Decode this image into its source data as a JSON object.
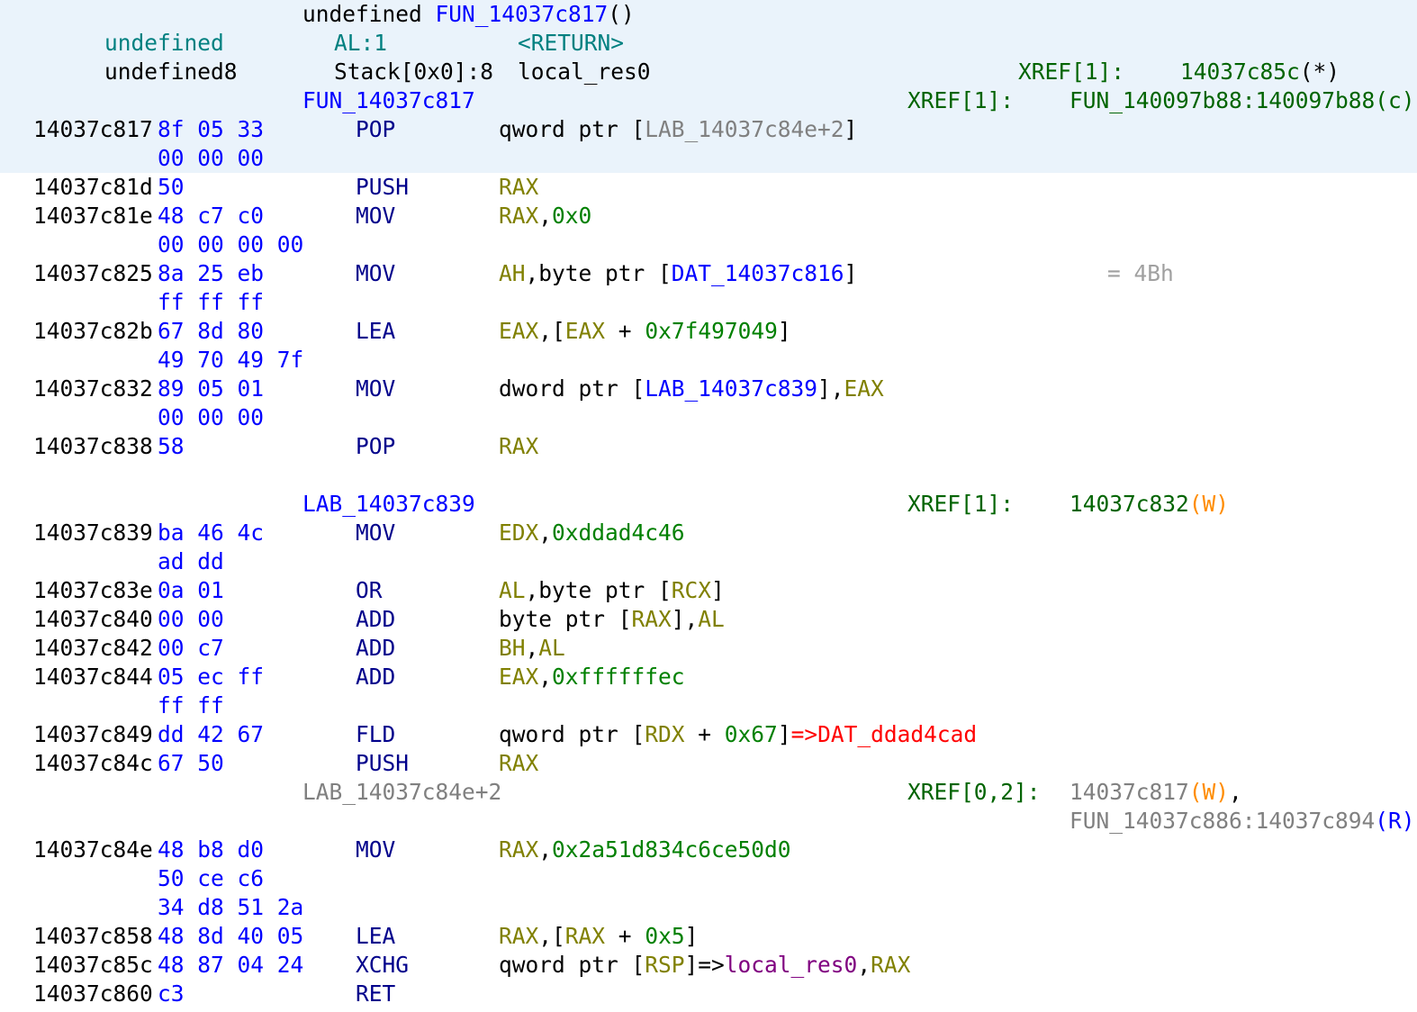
{
  "header": {
    "return_type": "undefined",
    "function_name": "FUN_14037c817",
    "parens": "()",
    "vars": [
      {
        "type": "undefined",
        "location": "AL:1",
        "name": "<RETURN>",
        "color": "#008080",
        "xref_label": "",
        "xref_target": "",
        "xref_flag": ""
      },
      {
        "type": "undefined8",
        "location": "Stack[0x0]:8",
        "name": "local_res0",
        "color": "#000000",
        "xref_label": "XREF[1]:",
        "xref_target": "14037c85c",
        "xref_flag": "(*)"
      }
    ]
  },
  "labels": [
    {
      "name": "FUN_14037c817",
      "style": "label",
      "xref_label": "XREF[1]:",
      "xref_targets": [
        {
          "text": "FUN_140097b88:140097b88",
          "flag": "(c)",
          "flag_style": "flag-c",
          "text_style": "xref"
        }
      ]
    },
    {
      "name": "LAB_14037c839",
      "style": "label",
      "xref_label": "XREF[1]:",
      "xref_targets": [
        {
          "text": "14037c832",
          "flag": "(W)",
          "flag_style": "flag-w",
          "text_style": "xref"
        }
      ]
    },
    {
      "name": "LAB_14037c84e+2",
      "style": "label-grey",
      "xref_label": "XREF[0,2]:",
      "xref_targets": [
        {
          "text": "14037c817",
          "flag": "(W)",
          "flag_style": "flag-w",
          "text_style": "xref-grey",
          "trail": ","
        },
        {
          "text": "FUN_14037c886:14037c894",
          "flag": "(R)",
          "flag_style": "flag-r",
          "text_style": "xref-grey"
        }
      ]
    }
  ],
  "instructions": [
    {
      "address": "14037c817",
      "bytes": [
        "8f 05 33",
        "00 00 00"
      ],
      "mnemonic": "POP",
      "operands": [
        {
          "t": "qword ptr [",
          "k": "plain"
        },
        {
          "t": "LAB_14037c84e+2",
          "k": "label-grey"
        },
        {
          "t": "]",
          "k": "plain"
        }
      ]
    },
    {
      "address": "14037c81d",
      "bytes": [
        "50"
      ],
      "mnemonic": "PUSH",
      "operands": [
        {
          "t": "RAX",
          "k": "reg"
        }
      ]
    },
    {
      "address": "14037c81e",
      "bytes": [
        "48 c7 c0",
        "00 00 00 00"
      ],
      "mnemonic": "MOV",
      "operands": [
        {
          "t": "RAX",
          "k": "reg"
        },
        {
          "t": ",",
          "k": "plain"
        },
        {
          "t": "0x0",
          "k": "num"
        }
      ]
    },
    {
      "address": "14037c825",
      "bytes": [
        "8a 25 eb",
        "ff ff ff"
      ],
      "mnemonic": "MOV",
      "operands": [
        {
          "t": "AH",
          "k": "reg"
        },
        {
          "t": ",byte ptr [",
          "k": "plain"
        },
        {
          "t": "DAT_14037c816",
          "k": "label"
        },
        {
          "t": "]",
          "k": "plain"
        }
      ],
      "eol": "= 4Bh"
    },
    {
      "address": "14037c82b",
      "bytes": [
        "67 8d 80",
        "49 70 49 7f"
      ],
      "mnemonic": "LEA",
      "operands": [
        {
          "t": "EAX",
          "k": "reg"
        },
        {
          "t": ",[",
          "k": "plain"
        },
        {
          "t": "EAX",
          "k": "reg"
        },
        {
          "t": " + ",
          "k": "plain"
        },
        {
          "t": "0x7f497049",
          "k": "num"
        },
        {
          "t": "]",
          "k": "plain"
        }
      ]
    },
    {
      "address": "14037c832",
      "bytes": [
        "89 05 01",
        "00 00 00"
      ],
      "mnemonic": "MOV",
      "operands": [
        {
          "t": "dword ptr [",
          "k": "plain"
        },
        {
          "t": "LAB_14037c839",
          "k": "label"
        },
        {
          "t": "],",
          "k": "plain"
        },
        {
          "t": "EAX",
          "k": "reg"
        }
      ]
    },
    {
      "address": "14037c838",
      "bytes": [
        "58"
      ],
      "mnemonic": "POP",
      "operands": [
        {
          "t": "RAX",
          "k": "reg"
        }
      ]
    },
    {
      "address": "14037c839",
      "bytes": [
        "ba 46 4c",
        "ad dd"
      ],
      "mnemonic": "MOV",
      "operands": [
        {
          "t": "EDX",
          "k": "reg"
        },
        {
          "t": ",",
          "k": "plain"
        },
        {
          "t": "0xddad4c46",
          "k": "num"
        }
      ]
    },
    {
      "address": "14037c83e",
      "bytes": [
        "0a 01"
      ],
      "mnemonic": "OR",
      "operands": [
        {
          "t": "AL",
          "k": "reg"
        },
        {
          "t": ",byte ptr [",
          "k": "plain"
        },
        {
          "t": "RCX",
          "k": "reg"
        },
        {
          "t": "]",
          "k": "plain"
        }
      ]
    },
    {
      "address": "14037c840",
      "bytes": [
        "00 00"
      ],
      "mnemonic": "ADD",
      "operands": [
        {
          "t": "byte ptr [",
          "k": "plain"
        },
        {
          "t": "RAX",
          "k": "reg"
        },
        {
          "t": "],",
          "k": "plain"
        },
        {
          "t": "AL",
          "k": "reg"
        }
      ]
    },
    {
      "address": "14037c842",
      "bytes": [
        "00 c7"
      ],
      "mnemonic": "ADD",
      "operands": [
        {
          "t": "BH",
          "k": "reg"
        },
        {
          "t": ",",
          "k": "plain"
        },
        {
          "t": "AL",
          "k": "reg"
        }
      ]
    },
    {
      "address": "14037c844",
      "bytes": [
        "05 ec ff",
        "ff ff"
      ],
      "mnemonic": "ADD",
      "operands": [
        {
          "t": "EAX",
          "k": "reg"
        },
        {
          "t": ",",
          "k": "plain"
        },
        {
          "t": "0xffffffec",
          "k": "num"
        }
      ]
    },
    {
      "address": "14037c849",
      "bytes": [
        "dd 42 67"
      ],
      "mnemonic": "FLD",
      "operands": [
        {
          "t": "qword ptr [",
          "k": "plain"
        },
        {
          "t": "RDX",
          "k": "reg"
        },
        {
          "t": " + ",
          "k": "plain"
        },
        {
          "t": "0x67",
          "k": "num"
        },
        {
          "t": "]",
          "k": "plain"
        },
        {
          "t": "=>DAT_ddad4cad",
          "k": "ref"
        }
      ]
    },
    {
      "address": "14037c84c",
      "bytes": [
        "67 50"
      ],
      "mnemonic": "PUSH",
      "operands": [
        {
          "t": "RAX",
          "k": "reg"
        }
      ]
    },
    {
      "address": "14037c84e",
      "bytes": [
        "48 b8 d0",
        "50 ce c6",
        "34 d8 51 2a"
      ],
      "mnemonic": "MOV",
      "operands": [
        {
          "t": "RAX",
          "k": "reg"
        },
        {
          "t": ",",
          "k": "plain"
        },
        {
          "t": "0x2a51d834c6ce50d0",
          "k": "num"
        }
      ]
    },
    {
      "address": "14037c858",
      "bytes": [
        "48 8d 40 05"
      ],
      "mnemonic": "LEA",
      "operands": [
        {
          "t": "RAX",
          "k": "reg"
        },
        {
          "t": ",[",
          "k": "plain"
        },
        {
          "t": "RAX",
          "k": "reg"
        },
        {
          "t": " + ",
          "k": "plain"
        },
        {
          "t": "0x5",
          "k": "num"
        },
        {
          "t": "]",
          "k": "plain"
        }
      ]
    },
    {
      "address": "14037c85c",
      "bytes": [
        "48 87 04 24"
      ],
      "mnemonic": "XCHG",
      "operands": [
        {
          "t": "qword ptr [",
          "k": "plain"
        },
        {
          "t": "RSP",
          "k": "reg"
        },
        {
          "t": "]=>",
          "k": "plain"
        },
        {
          "t": "local_res0",
          "k": "local"
        },
        {
          "t": ",",
          "k": "plain"
        },
        {
          "t": "RAX",
          "k": "reg"
        }
      ]
    },
    {
      "address": "14037c860",
      "bytes": [
        "c3"
      ],
      "mnemonic": "RET",
      "operands": []
    }
  ]
}
